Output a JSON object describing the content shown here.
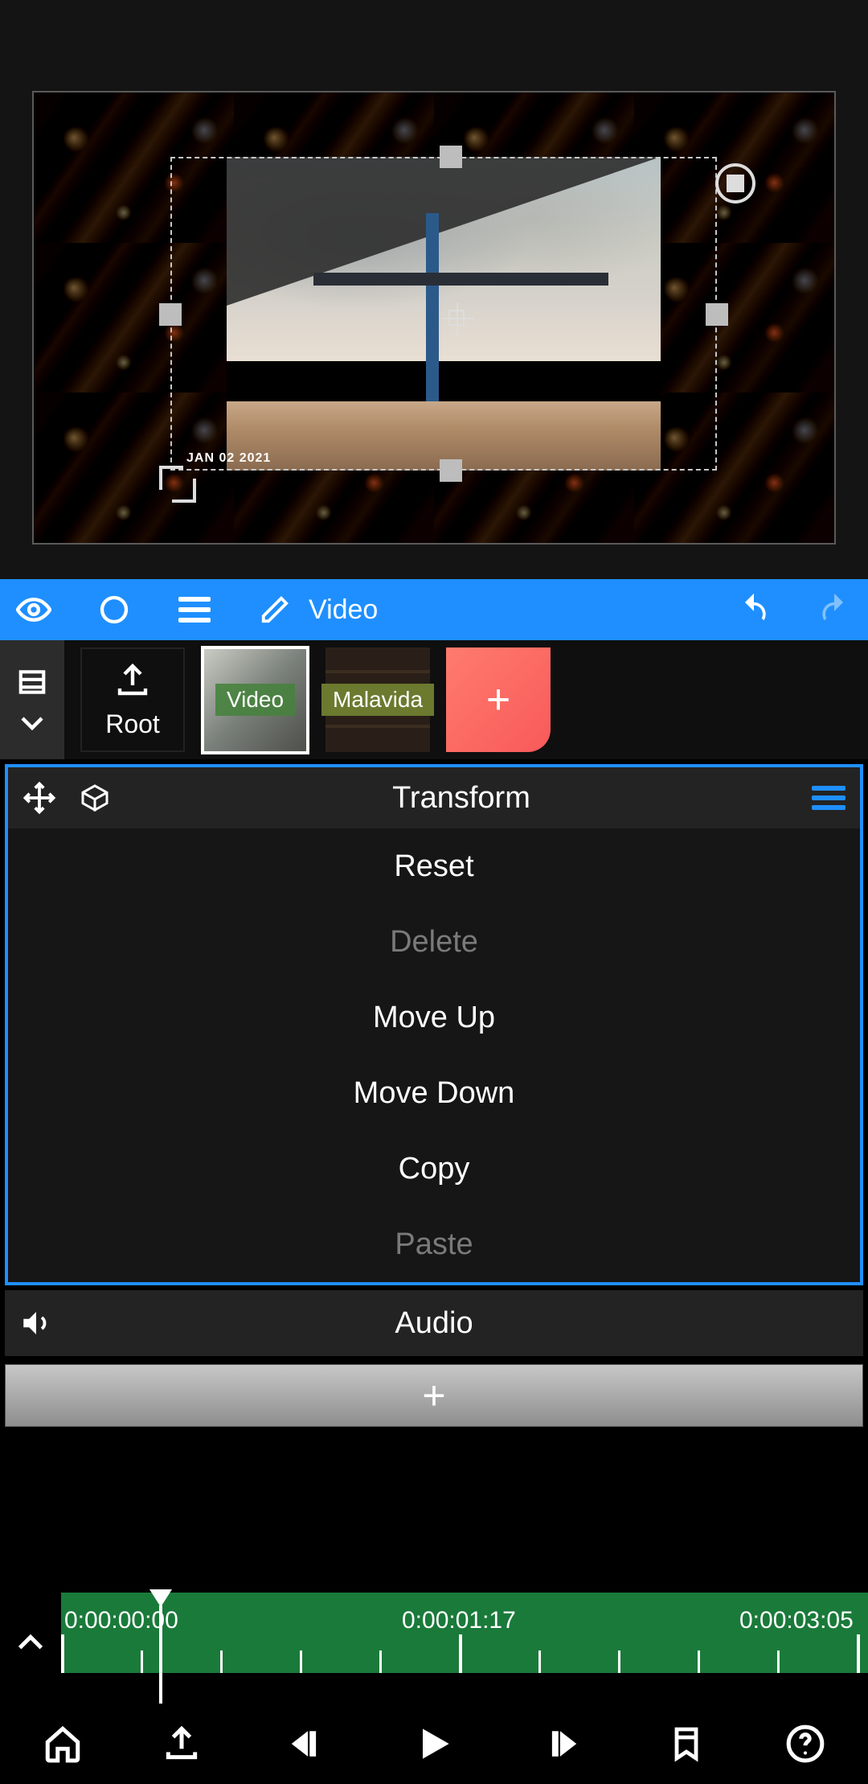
{
  "preview": {
    "datestamp": "JAN 02 2021"
  },
  "toolbar": {
    "edit_label": "Video"
  },
  "layer_strip": {
    "root_label": "Root",
    "thumbs": [
      {
        "label": "Video"
      },
      {
        "label": "Malavida"
      }
    ]
  },
  "transform_panel": {
    "title": "Transform",
    "items": [
      {
        "label": "Reset",
        "enabled": true
      },
      {
        "label": "Delete",
        "enabled": false
      },
      {
        "label": "Move Up",
        "enabled": true
      },
      {
        "label": "Move Down",
        "enabled": true
      },
      {
        "label": "Copy",
        "enabled": true
      },
      {
        "label": "Paste",
        "enabled": false
      }
    ]
  },
  "audio_row": {
    "title": "Audio"
  },
  "timeline": {
    "labels": [
      "0:00:00:00",
      "0:00:01:17",
      "0:00:03:05"
    ]
  }
}
